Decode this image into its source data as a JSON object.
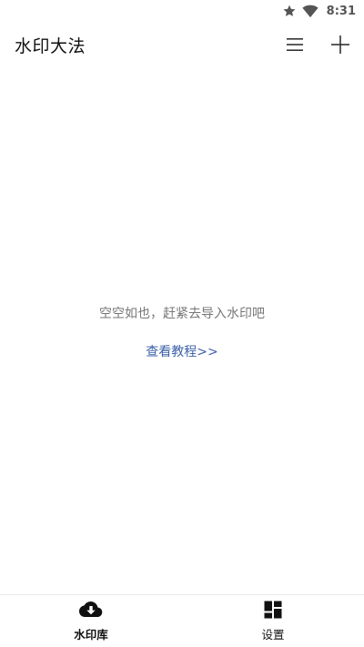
{
  "status_bar": {
    "time": "8:31",
    "icons": [
      "star-icon",
      "wifi-icon"
    ]
  },
  "app_bar": {
    "title": "水印大法",
    "actions": [
      "list-icon",
      "add-icon"
    ]
  },
  "empty_state": {
    "message": "空空如也，赶紧去导入水印吧",
    "link": "查看教程>>",
    "link_color": "#3b5fa8"
  },
  "bottom_nav": {
    "items": [
      {
        "label": "水印库",
        "icon": "cloud-download-icon",
        "active": true
      },
      {
        "label": "设置",
        "icon": "dashboard-icon",
        "active": false
      }
    ]
  }
}
